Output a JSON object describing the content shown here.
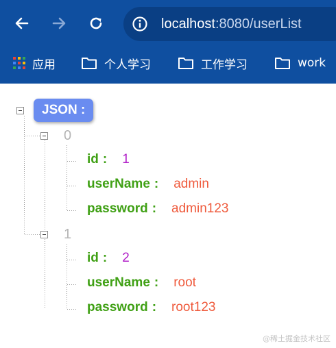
{
  "browser": {
    "url_host": "localhost",
    "url_rest": ":8080/userList",
    "bookmarks": [
      {
        "label": "应用",
        "icon": "apps-grid-icon"
      },
      {
        "label": "个人学习",
        "icon": "folder-icon"
      },
      {
        "label": "工作学习",
        "icon": "folder-icon"
      },
      {
        "label": "work",
        "icon": "folder-icon"
      }
    ]
  },
  "json_viewer": {
    "root_label": "JSON :",
    "items": [
      {
        "index": "0",
        "fields": [
          {
            "key": "id",
            "colon": ":",
            "value": "1",
            "type": "number"
          },
          {
            "key": "userName",
            "colon": ":",
            "value": "admin",
            "type": "string"
          },
          {
            "key": "password",
            "colon": ":",
            "value": "admin123",
            "type": "string"
          }
        ]
      },
      {
        "index": "1",
        "fields": [
          {
            "key": "id",
            "colon": ":",
            "value": "2",
            "type": "number"
          },
          {
            "key": "userName",
            "colon": ":",
            "value": "root",
            "type": "string"
          },
          {
            "key": "password",
            "colon": ":",
            "value": "root123",
            "type": "string"
          }
        ]
      }
    ]
  },
  "colors": {
    "chrome_bg": "#0f4fa0",
    "root_badge": "#6a8cf0",
    "key": "#3fa014",
    "number_value": "#b120c8",
    "string_value": "#ef5a3c"
  },
  "watermark": "@稀土掘金技术社区"
}
